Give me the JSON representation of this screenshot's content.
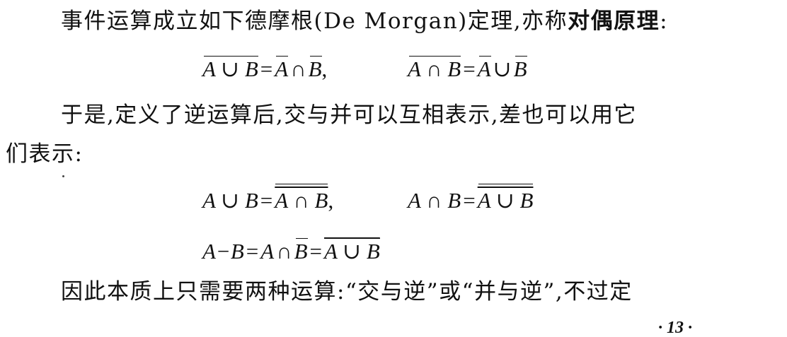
{
  "para1": {
    "text": "事件运算成立如下德摩根(De Morgan)定理,亦称",
    "bold": "对偶原理",
    "end": ":"
  },
  "formula1": {
    "left_lhs": "A ∪ B",
    "left_rhs_a": "A",
    "left_op": "∩",
    "left_rhs_b": "B",
    "comma": ",",
    "right_lhs": "A ∩ B",
    "right_rhs_a": "A",
    "right_op": "∪",
    "right_rhs_b": "B"
  },
  "para2": {
    "line1": "于是,定义了逆运算后,交与并可以互相表示,差也可以用它",
    "line2": "们表示:"
  },
  "formula2": {
    "union_lhs": "A ∪ B",
    "union_inner": "A ∩ B",
    "comma": ",",
    "inter_lhs": "A ∩ B",
    "inter_inner": "A ∪ B"
  },
  "formula3": {
    "lhs": "A−B",
    "mid_a": "A",
    "mid_op": "∩",
    "mid_b": "B",
    "rhs": "A ∪ B"
  },
  "para3": {
    "text": "因此本质上只需要两种运算:“交与逆”或“并与逆”,不过定"
  },
  "page_number": "· 13 ·"
}
